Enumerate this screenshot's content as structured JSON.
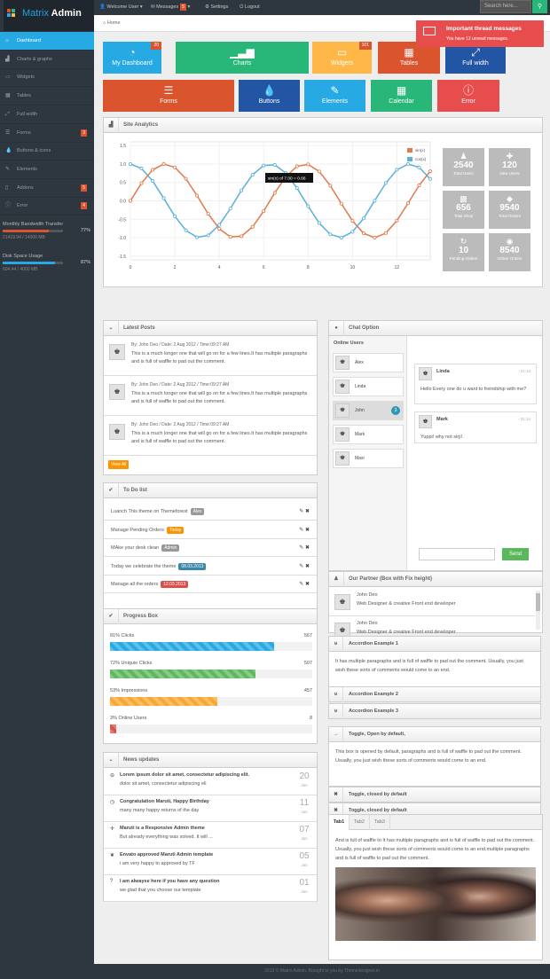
{
  "brand": {
    "title_a": "Matrix",
    "title_b": " Admin",
    "colors": [
      "#da542e",
      "#28b779",
      "#27a9e3",
      "#ffb848"
    ]
  },
  "topnav": {
    "welcome": "Welcome User",
    "messages": "Messages",
    "messages_count": "5",
    "settings": "Settings",
    "logout": "Logout",
    "search_placeholder": "Search here...",
    "search_icon": "search-icon"
  },
  "breadcrumb": {
    "home": "Home"
  },
  "notification": {
    "title": "Important thread messages",
    "text": "You have 12 unread messages."
  },
  "sidebar": {
    "items": [
      {
        "label": "Dashboard",
        "icon": "home-icon",
        "active": true
      },
      {
        "label": "Charts & graphs",
        "icon": "signal-icon"
      },
      {
        "label": "Widgets",
        "icon": "inbox-icon"
      },
      {
        "label": "Tables",
        "icon": "th-icon"
      },
      {
        "label": "Full width",
        "icon": "fullscreen-icon"
      },
      {
        "label": "Forms",
        "icon": "th-list-icon",
        "badge": "3"
      },
      {
        "label": "Buttons & icons",
        "icon": "tint-icon"
      },
      {
        "label": "Elements",
        "icon": "pencil-icon"
      },
      {
        "label": "Addons",
        "icon": "file-icon",
        "badge": "5"
      },
      {
        "label": "Error",
        "icon": "info-icon",
        "badge": "4"
      }
    ],
    "stats": [
      {
        "label": "Monthly Bandwidth Transfer",
        "pct": "77%",
        "value": 0.77,
        "sub": "21419.94 / 14000 MB",
        "color": "#da542e"
      },
      {
        "label": "Disk Space Usage",
        "pct": "87%",
        "value": 0.87,
        "sub": "604.44 / 4000 MB",
        "color": "#27a9e3"
      }
    ]
  },
  "quick": [
    {
      "label": "My Dashboard",
      "icon": "dashboard-icon",
      "badge": "20",
      "color": "#27a9e3"
    },
    {
      "label": "Charts",
      "icon": "chart-icon",
      "color": "#28b779"
    },
    {
      "label": "Widgets",
      "icon": "inbox-icon",
      "badge": "101",
      "color": "#ffb848"
    },
    {
      "label": "Tables",
      "icon": "th-icon",
      "color": "#da542e"
    },
    {
      "label": "Full width",
      "icon": "fullscreen-icon",
      "color": "#2255a4"
    },
    {
      "label": "Forms",
      "icon": "th-list-icon",
      "color": "#da542e"
    },
    {
      "label": "Buttons",
      "icon": "tint-icon",
      "color": "#2255a4"
    },
    {
      "label": "Elements",
      "icon": "pencil-icon",
      "color": "#27a9e3"
    },
    {
      "label": "Calendar",
      "icon": "calendar-icon",
      "color": "#28b779"
    },
    {
      "label": "Error",
      "icon": "info-icon",
      "color": "#e84d4d"
    }
  ],
  "analytics": {
    "title": "Site Analytics",
    "tooltip": "sin(x) of 7.00 = 0.66",
    "stats": [
      {
        "value": "2540",
        "label": "Total Users",
        "icon": "user-icon"
      },
      {
        "value": "120",
        "label": "New Users",
        "icon": "plus-icon"
      },
      {
        "value": "656",
        "label": "Total Shop",
        "icon": "shopping-cart-icon"
      },
      {
        "value": "9540",
        "label": "Total Orders",
        "icon": "tag-icon"
      },
      {
        "value": "10",
        "label": "Pending Orders",
        "icon": "repeat-icon"
      },
      {
        "value": "8540",
        "label": "Online Orders",
        "icon": "globe-icon"
      }
    ]
  },
  "chart_data": {
    "type": "line",
    "xlim": [
      0,
      13.5
    ],
    "ylim": [
      -1.6,
      1.6
    ],
    "xticks": [
      "0",
      "2",
      "4",
      "6",
      "8",
      "10",
      "12"
    ],
    "yticks": [
      "1.5",
      "1.0",
      "0.5",
      "0.0",
      "-0.5",
      "-1.0",
      "-1.5"
    ],
    "legend": "top-right",
    "grid": true,
    "series": [
      {
        "name": "sin(x)",
        "color": "#e0794b",
        "function": "sin",
        "x_from": 0,
        "x_to": 13.5,
        "x_step": 0.5
      },
      {
        "name": "cos(x)",
        "color": "#5bafd8",
        "function": "cos",
        "x_from": 0,
        "x_to": 13.5,
        "x_step": 0.5
      }
    ]
  },
  "posts": {
    "title": "Latest Posts",
    "button": "View All",
    "items": [
      {
        "meta": "By: John Deo / Date: 2 Aug 2012 / Time:09:27 AM",
        "text": "This is a much longer one that will go on for a few lines.It has multiple paragraphs and is full of waffle to pad out the comment."
      },
      {
        "meta": "By: John Deo / Date: 2 Aug 2012 / Time:09:27 AM",
        "text": "This is a much longer one that will go on for a few lines.It has multiple paragraphs and is full of waffle to pad out the comment."
      },
      {
        "meta": "By: John Deo / Date: 2 Aug 2012 / Time:09:27 AM",
        "text": "This is a much longer one that will go on for a few lines.It has multiple paragraphs and is full of waffle to pad out the comment."
      }
    ]
  },
  "todo": {
    "title": "To Do list",
    "items": [
      {
        "text": "Luanch This theme on Themeforest",
        "tag": "Alex",
        "color": "#999"
      },
      {
        "text": "Manage Pending Orders",
        "tag": "Today",
        "color": "#f89406"
      },
      {
        "text": "MAke your desk clean",
        "tag": "Admin",
        "color": "#999"
      },
      {
        "text": "Today we celebrate the theme",
        "tag": "08.03.2013",
        "color": "#3a87ad"
      },
      {
        "text": "Manage all the orders",
        "tag": "12.03.2013",
        "color": "#da4f49"
      }
    ]
  },
  "progress": {
    "title": "Progress Box",
    "items": [
      {
        "label": "81% Clicks",
        "value": "567",
        "pct": 0.81,
        "color": "#27a9e3"
      },
      {
        "label": "72% Uniquie Clicks",
        "value": "507",
        "pct": 0.72,
        "color": "#5eb95e"
      },
      {
        "label": "53% Impressions",
        "value": "457",
        "pct": 0.53,
        "color": "#faa732"
      },
      {
        "label": "3% Online Users",
        "value": "8",
        "pct": 0.03,
        "color": "#dd514c"
      }
    ]
  },
  "news": {
    "title": "News updates",
    "items": [
      {
        "title": "Lorem ipsum dolor sit amet, consectetur adipiscing elit.",
        "desc": "dolor sit amet, consectetur adipiscing eli",
        "day": "20",
        "month": "Jan",
        "icon": "minus-circle-icon"
      },
      {
        "title": "Congratulation Maruti, Happy Birthday",
        "desc": "many many happy returns of the day",
        "day": "11",
        "month": "Jan",
        "icon": "time-icon"
      },
      {
        "title": "Maruti is a Responsive Admin theme",
        "desc": "But already everything was solved. It will ...",
        "day": "07",
        "month": "Jan",
        "icon": "move-icon"
      },
      {
        "title": "Envato approved Maruti Admin template",
        "desc": "i am very happy to approved by TF",
        "day": "05",
        "month": "Jan",
        "icon": "leaf-icon"
      },
      {
        "title": "I am alwayse here if you have any question",
        "desc": "we glad that you choose our template",
        "day": "01",
        "month": "Jan",
        "icon": "question-icon"
      }
    ]
  },
  "chat": {
    "title": "Chat Option",
    "users_title": "Online Users",
    "users": [
      {
        "name": "Alex"
      },
      {
        "name": "Linda"
      },
      {
        "name": "John",
        "count": "3"
      },
      {
        "name": "Mark"
      },
      {
        "name": "Maxi"
      }
    ],
    "messages": [
      {
        "name": "Linda",
        "time": "- 21:14",
        "text": "Hello Every one do u want to freindship with me?"
      },
      {
        "name": "Mark",
        "time": "- 21:14",
        "text": "Yuppi! why not sirji!."
      }
    ],
    "send": "Send"
  },
  "partner": {
    "title": "Our Partner (Box with Fix height)",
    "items": [
      {
        "name": "John Deo",
        "role": "Web Designer & creative Front end developer"
      },
      {
        "name": "John Deo",
        "role": "Web Designer & creative Front end developer"
      }
    ]
  },
  "accordion": {
    "items": [
      {
        "title": "Accordion Example 1",
        "body": "It has multiple paragraphs and is full of waffle to pad out the comment. Usually, you just wish these sorts of comments would come to an end."
      },
      {
        "title": "Accordion Example 2"
      },
      {
        "title": "Accordion Example 3"
      }
    ]
  },
  "toggle": {
    "items": [
      {
        "title": "Toggle, Open by default,",
        "body": "This box is opened by default, paragraphs and is full of waffle to pad out the comment. Usually, you just wish these sorts of comments would come to an end."
      },
      {
        "title": "Toggle, closed by default"
      },
      {
        "title": "Toggle, closed by default"
      }
    ]
  },
  "tabs": {
    "labels": [
      "Tab1",
      "Tab2",
      "Tab3"
    ],
    "body": "And is full of waffle to It has multiple paragraphs and is full of waffle to pad out the comment. Usually, you just wish these sorts of comments would come to an end.multiple paragraphs and is full of waffle to pad out the comment."
  },
  "footer": {
    "text": "2013 © Matrix Admin. Brought to you by Themedesigner.in"
  }
}
